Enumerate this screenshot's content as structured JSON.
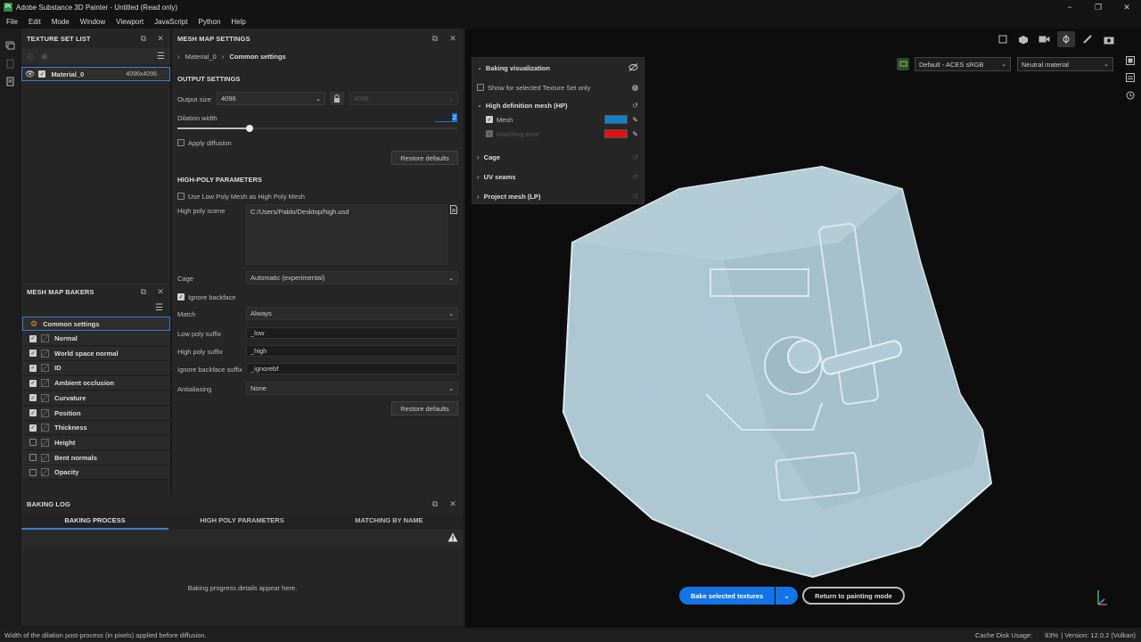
{
  "window": {
    "title": "Adobe Substance 3D Painter - Untitled (Read only)",
    "logo": "Pt",
    "minimize": "−",
    "maximize": "❐",
    "close": "✕"
  },
  "menu": [
    "File",
    "Edit",
    "Mode",
    "Window",
    "Viewport",
    "JavaScript",
    "Python",
    "Help"
  ],
  "texture_set_list": {
    "title": "TEXTURE SET LIST",
    "material_name": "Material_0",
    "material_size": "4096x4096"
  },
  "mesh_map_bakers": {
    "title": "MESH MAP BAKERS",
    "common_settings": "Common settings",
    "items": [
      {
        "label": "Normal",
        "checked": true
      },
      {
        "label": "World space normal",
        "checked": true
      },
      {
        "label": "ID",
        "checked": true
      },
      {
        "label": "Ambient occlusion",
        "checked": true
      },
      {
        "label": "Curvature",
        "checked": true
      },
      {
        "label": "Position",
        "checked": true
      },
      {
        "label": "Thickness",
        "checked": true
      },
      {
        "label": "Height",
        "checked": false
      },
      {
        "label": "Bent normals",
        "checked": false
      },
      {
        "label": "Opacity",
        "checked": false
      }
    ]
  },
  "mesh_map_settings": {
    "title": "MESH MAP SETTINGS",
    "breadcrumb_material": "Material_0",
    "breadcrumb_section": "Common settings",
    "output_settings_title": "OUTPUT SETTINGS",
    "output_size_label": "Output size",
    "output_size_value": "4096",
    "output_size_linked": "4096",
    "dilation_label": "Dilation width",
    "dilation_value": "2",
    "apply_diffusion_label": "Apply diffusion",
    "restore_defaults": "Restore defaults",
    "high_poly_title": "HIGH-POLY PARAMETERS",
    "use_low_poly_label": "Use Low Poly Mesh as High Poly Mesh",
    "high_poly_scene_label": "High poly scene",
    "high_poly_scene_value": "C:/Users/Pablo/Desktop/high.usd",
    "cage_label": "Cage",
    "cage_value": "Automatic (experimental)",
    "ignore_backface_label": "Ignore backface",
    "match_label": "Match",
    "match_value": "Always",
    "low_poly_suffix_label": "Low poly suffix",
    "low_poly_suffix_value": "_low",
    "high_poly_suffix_label": "High poly suffix",
    "high_poly_suffix_value": "_high",
    "ignore_backface_suffix_label": "Ignore backface suffix",
    "ignore_backface_suffix_value": "_ignorebf",
    "antialiasing_label": "Antialiasing",
    "antialiasing_value": "None",
    "restore_defaults_2": "Restore defaults"
  },
  "baking_log": {
    "title": "BAKING LOG",
    "tabs": [
      "BAKING PROCESS",
      "HIGH POLY PARAMETERS",
      "MATCHING BY NAME"
    ],
    "placeholder": "Baking progress details appear here."
  },
  "viewport": {
    "color_profile": "Default - ACES sRGB",
    "material_mode": "Neutral material",
    "bake_button": "Bake selected textures",
    "return_button": "Return to painting mode"
  },
  "baking_visualization": {
    "title": "Baking visualization",
    "show_selected": "Show for selected Texture Set only",
    "hp_title": "High definition mesh (HP)",
    "mesh_label": "Mesh",
    "mesh_color": "#1480c8",
    "matching_error_label": "Matching error",
    "matching_error_color": "#e01010",
    "cage_label": "Cage",
    "uv_seams_label": "UV seams",
    "project_mesh_label": "Project mesh (LP)"
  },
  "status": {
    "hint": "Width of the dilation post-process (in pixels) applied before diffusion.",
    "cache_label": "Cache Disk Usage:",
    "cache_value": "83%",
    "version": "| Version: 12.0.2 (Vulkan)"
  },
  "colors": {
    "accent": "#1473e6",
    "panel": "#262626",
    "background": "#1a1a1a",
    "viewport": "#0d0d0d",
    "model": "#a9c3cf"
  }
}
